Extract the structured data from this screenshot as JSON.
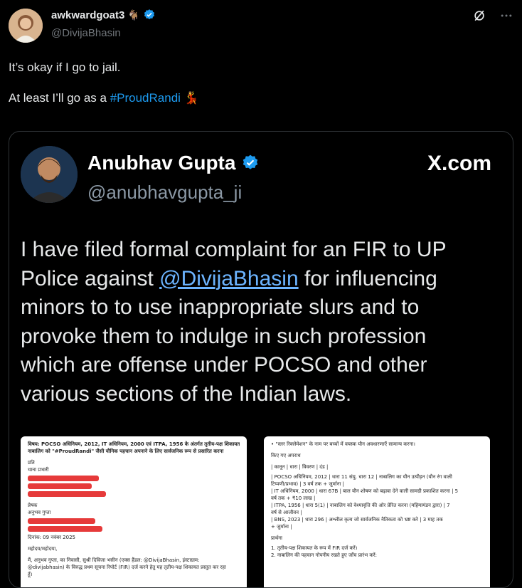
{
  "author": {
    "display_name": "awkwardgoat3",
    "emoji": "🐐",
    "handle": "@DivijaBhasin"
  },
  "tweet": {
    "line1": "It’s okay if I go to jail.",
    "line2_prefix": "At least I’ll go as a ",
    "hashtag": "#ProudRandi",
    "emoji": "💃"
  },
  "embed": {
    "display_name": "Anubhav Gupta",
    "handle": "@anubhavgupta_ji",
    "brand": "X.com",
    "text_part1": "I have filed formal complaint for an FIR to UP Police against ",
    "mention": "@DivijaBhasin",
    "text_part2": " for influencing minors to to use inappropriate slurs and to provoke them  to indulge in such profession which are offense under POCSO and other various sections of the Indian laws."
  },
  "doc_left": {
    "lines": [
      "विषय: POCSO अधिनियम, 2012, IT अधिनियम, 2000 एवं ITPA, 1956 के अंतर्गत तृतीय-पक्ष शिकायत –",
      "नाबालिग को \"#ProudRandi\" जैसी यौनिक पहचान अपनाने के लिए सार्वजनिक रूप से प्रसारित करना",
      "प्रति",
      "थाना प्रभारी",
      "प्रेषक",
      "अनुभव गुप्ता",
      "दिनांक: 09 नवंबर 2025",
      "महोदय/महोदया,",
      "मैं, अनुभव गुप्ता,                 का निवासी, सुश्री दिविजा भसीन (एक्स हैंडल: @DivijaBhasin, इंस्टाग्राम:",
      "@divijabhasin) के विरुद्ध प्रथम सूचना रिपोर्ट (FIR) दर्ज करने हेतु यह तृतीय-पक्ष शिकायत प्रस्तुत कर रहा",
      "हूँ।"
    ]
  },
  "doc_right": {
    "lines": [
      "• \"स्लर रिक्लेमेशन\" के नाम पर बच्चों में वयस्क यौन अवधारणाएँ सामान्य करना।",
      "किए गए अपराध",
      "| कानून          | धारा          | विवरण                                    | दंड          |",
      "| POCSO अधिनियम, 2012 | धारा 11 संयु. धारा 12 | नाबालिग का यौन उत्पीड़न (यौन रंग वाली",
      "टिप्पणी/प्रभाव) | 3 वर्ष तक + जुर्माना  |",
      "| IT अधिनियम, 2000   | धारा 67B     | बाल यौन शोषण को बढ़ावा देने वाली सामग्री प्रकाशित करना | 5",
      "वर्ष तक + ₹10 लाख    |",
      "| ITPA, 1956       | धारा 5(1)     | नाबालिग को वेश्यावृत्ति की ओर प्रेरित करना (महिमामंडन द्वारा) | 7",
      "वर्ष से आजीवन    |",
      "| BNS, 2023        | धारा 296     | अश्लील कृत्य जो सार्वजनिक नैतिकता को भ्रष्ट करे  | 3 माह तक",
      "+ जुर्माना    |",
      "प्रार्थना",
      "1. तृतीय-पक्ष शिकायत के रूप में FIR दर्ज करें।",
      "2. नाबालिग की पहचान गोपनीय रखते हुए जाँच प्रारंभ करें:"
    ]
  },
  "colors": {
    "background": "#000000",
    "text": "#e7e9ea",
    "secondary": "#71767b",
    "accent": "#1d9bf0"
  }
}
